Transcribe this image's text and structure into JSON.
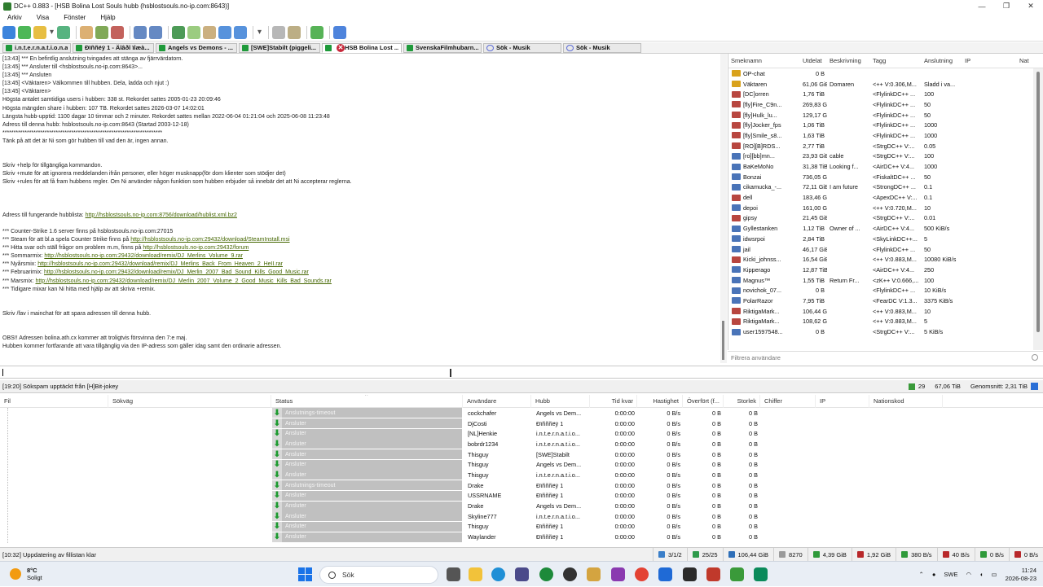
{
  "window": {
    "title": "DC++ 0.883 - [HSB Bolina Lost Souls hubb (hsblostsouls.no-ip.com:8643)]",
    "controls": [
      "—",
      "❐",
      "✕"
    ]
  },
  "menu": [
    "Arkiv",
    "Visa",
    "Fönster",
    "Hjälp"
  ],
  "toolbar": {
    "buttons": [
      "back-icon",
      "reconnect-icon",
      "favorite-hubs-icon",
      "favorite-dropdown-icon",
      "public-hubs-icon",
      "separator",
      "queue-icon",
      "finished-icon",
      "upload-queue-icon",
      "separator",
      "search-icon",
      "adl-search-icon",
      "separator",
      "spy-icon",
      "notepad-icon",
      "network-stats-icon",
      "download-icon",
      "refresh-icon",
      "separator",
      "settings-dropdown-icon",
      "separator",
      "gear-icon",
      "edit-icon",
      "separator",
      "plugin-icon",
      "separator",
      "help-icon"
    ]
  },
  "tabs": [
    {
      "label": "i.n.t.e.r.n.a.t.i.o.n.a.l...",
      "type": "hub",
      "width": 84
    },
    {
      "label": "Đïññëÿ 1 - Äîâðî ïîæà...",
      "type": "hub",
      "width": 100
    },
    {
      "label": "Angels vs Demons - ...",
      "type": "hub",
      "width": 100
    },
    {
      "label": "[SWE]Stabilt (piggeli...",
      "type": "hub",
      "width": 100
    },
    {
      "label": "HSB Bolina Lost ...",
      "type": "hub",
      "width": 98,
      "active": true,
      "close": "✕"
    },
    {
      "label": "SvenskaFilmhubarn...",
      "type": "hub",
      "width": 96
    },
    {
      "label": "Sök - Musik",
      "type": "search",
      "width": 96
    },
    {
      "label": "Sök - Musik",
      "type": "search",
      "width": 96
    }
  ],
  "chat": {
    "lines": [
      {
        "t": "[13:43] *** En befintlig anslutning tvingades att stänga av fjärrvärdatorn."
      },
      {
        "t": "[13:45] *** Ansluter till <hsblostsouls.no-ip.com:8643>..."
      },
      {
        "t": "[13:45] *** Ansluten"
      },
      {
        "t": "[13:45] <Väktaren> Välkommen till hubben. Dela, ladda och njut :)"
      },
      {
        "t": "[13:45] <Väktaren>"
      },
      {
        "t": "Högsta antalet samtidiga users i hubben: 338 st. Rekordet sattes 2005-01-23 20:09:46"
      },
      {
        "t": "Högsta mängden share i hubben: 107 TB. Rekordet sattes 2026-03-07 14:02:01"
      },
      {
        "t": "Längsta hubb-upptid: 1100 dagar 10 timmar och 2 minuter. Rekordet sattes mellan 2022-06-04 01:21:04 och 2025-06-08 11:23:48"
      },
      {
        "t": "Adress till denna hubb: hsblostsouls.no-ip.com:8643 (Startad 2003-12-18)"
      },
      {
        "t": "************************************************************************"
      },
      {
        "t": "Tänk på att det är Ni som gör hubben till vad den är, ingen annan."
      },
      {
        "t": ""
      },
      {
        "t": ""
      },
      {
        "t": "Skriv +help för tillgängliga kommandon."
      },
      {
        "t": "Skriv +mute för att ignorera meddelanden ifrån personer, eller höger musknapp(för dom klienter som stödjer det)"
      },
      {
        "t": "Skriv +rules för att få fram hubbens regler. Om Ni använder någon funktion som hubben erbjuder så innebär det att Ni accepterar reglerna."
      },
      {
        "t": ""
      },
      {
        "t": ""
      },
      {
        "t": ""
      },
      {
        "t": "Adress till fungerande hubblista: ",
        "link": "http://hsblostsouls.no-ip.com:8756/download/hublist.xml.bz2"
      },
      {
        "t": ""
      },
      {
        "t": "*** Counter-Strike 1.6 server finns på hsblostsouls.no-ip.com:27015"
      },
      {
        "t": "*** Steam för att bl.a spela Counter Strike finns på ",
        "link": "http://hsblostsouls.no-ip.com:29432/download/SteamInstall.msi"
      },
      {
        "t": "*** Hitta svar och ställ frågor om problem m.m, finns på ",
        "link": "http://hsblostsouls.no-ip.com:29432/forum"
      },
      {
        "t": "*** Sommarmix: ",
        "link": "http://hsblostsouls.no-ip.com:29432/download/remix/DJ_Merlins_Volume_9.rar"
      },
      {
        "t": "*** Nyårsmix: ",
        "link": "http://hsblostsouls.no-ip.com:29432/download/remix/DJ_Merlins_Back_From_Heaven_2_HeII.rar"
      },
      {
        "t": "*** Februarimix: ",
        "link": "http://hsblostsouls.no-ip.com:29432/download/remix/DJ_Merlin_2007_Bad_Sound_Kills_Good_Music.rar"
      },
      {
        "t": "*** Marsmix: ",
        "link": "http://hsblostsouls.no-ip.com:29432/download/remix/DJ_Merlin_2007_Volume_2_Good_Music_Kills_Bad_Sounds.rar"
      },
      {
        "t": "*** Tidigare mixar kan Ni hitta med hjälp av att skriva +remix."
      },
      {
        "t": ""
      },
      {
        "t": ""
      },
      {
        "t": "Skriv /fav i mainchat för att spara adressen till denna hubb."
      },
      {
        "t": ""
      },
      {
        "t": ""
      },
      {
        "t": "OBS!! Adressen bolina.ath.cx kommer att troligtvis försvinna den 7:e maj."
      },
      {
        "t": "Hubben kommer fortfarande att vara tillgänglig via den IP-adress som gäller idag samt den ordinarie adressen."
      }
    ]
  },
  "users": {
    "columns": [
      {
        "label": "Smeknamn",
        "w": 88
      },
      {
        "label": "Utdelat",
        "w": 33
      },
      {
        "label": "Beskrivning",
        "w": 53
      },
      {
        "label": "Tagg",
        "w": 63
      },
      {
        "label": "Anslutning",
        "w": 50
      },
      {
        "label": "IP",
        "w": 67
      },
      {
        "label": "Nat",
        "w": 22
      }
    ],
    "rows": [
      {
        "nick": "OP-chat",
        "share": "0 B",
        "desc": "",
        "tag": "",
        "conn": "",
        "icon": "#d9a21b"
      },
      {
        "nick": "Väktaren",
        "share": "61,06 GiB",
        "desc": "Domaren",
        "tag": "<++ V:0.306,M...",
        "conn": "Sladd i va...",
        "icon": "#d9a21b"
      },
      {
        "nick": "[DC]orren",
        "share": "1,76 TiB",
        "desc": "",
        "tag": "<FlylinkDC++ ...",
        "conn": "100",
        "icon": "#b8463f"
      },
      {
        "nick": "[fly]Fire_C9n...",
        "share": "269,83 GiB",
        "desc": "",
        "tag": "<FlylinkDC++ ...",
        "conn": "50",
        "icon": "#b8463f"
      },
      {
        "nick": "[fly]Hulk_lu...",
        "share": "129,17 GiB",
        "desc": "",
        "tag": "<FlylinkDC++ ...",
        "conn": "50",
        "icon": "#b8463f"
      },
      {
        "nick": "[fly]Jocker_fps",
        "share": "1,06 TiB",
        "desc": "",
        "tag": "<FlylinkDC++ ...",
        "conn": "1000",
        "icon": "#b8463f"
      },
      {
        "nick": "[fly]Smile_s8...",
        "share": "1,63 TiB",
        "desc": "",
        "tag": "<FlylinkDC++ ...",
        "conn": "1000",
        "icon": "#b8463f"
      },
      {
        "nick": "[RO][B]RDS...",
        "share": "2,77 TiB",
        "desc": "",
        "tag": "<StrgDC++ V:...",
        "conn": "0.05",
        "icon": "#b8463f"
      },
      {
        "nick": "[ro][bb]mn...",
        "share": "23,93 GiB",
        "desc": "cable",
        "tag": "<StrgDC++ V:...",
        "conn": "100",
        "icon": "#4a74b8"
      },
      {
        "nick": "BaKeMoNo",
        "share": "31,38 TiB",
        "desc": "Looking f...",
        "tag": "<AirDC++ V:4...",
        "conn": "1000",
        "icon": "#4a74b8"
      },
      {
        "nick": "Bonzai",
        "share": "736,05 GiB",
        "desc": "",
        "tag": "<FiskaltDC++ ...",
        "conn": "50",
        "icon": "#4a74b8"
      },
      {
        "nick": "cikamucka_-...",
        "share": "72,11 GiB",
        "desc": "I am future",
        "tag": "<StrongDC++ ...",
        "conn": "0.1",
        "icon": "#4a74b8"
      },
      {
        "nick": "dell",
        "share": "183,46 GiB",
        "desc": "",
        "tag": "<ApexDC++ V:...",
        "conn": "0.1",
        "icon": "#b8463f"
      },
      {
        "nick": "depoi",
        "share": "161,00 GiB",
        "desc": "",
        "tag": "<++ V:0.720,M...",
        "conn": "10",
        "icon": "#4a74b8"
      },
      {
        "nick": "gipsy",
        "share": "21,45 GiB",
        "desc": "",
        "tag": "<StrgDC++ V:...",
        "conn": "0.01",
        "icon": "#b8463f"
      },
      {
        "nick": "Gyllestanken",
        "share": "1,12 TiB",
        "desc": "Owner of ...",
        "tag": "<AirDC++ V:4...",
        "conn": "500 KiB/s",
        "icon": "#4a74b8"
      },
      {
        "nick": "idwsrpoi",
        "share": "2,84 TiB",
        "desc": "",
        "tag": "<SkyLinkDC++...",
        "conn": "5",
        "icon": "#4a74b8"
      },
      {
        "nick": "jail",
        "share": "46,17 GiB",
        "desc": "",
        "tag": "<FlylinkDC++ ...",
        "conn": "50",
        "icon": "#4a74b8"
      },
      {
        "nick": "Kicki_johnss...",
        "share": "16,54 GiB",
        "desc": "",
        "tag": "<++ V:0.883,M...",
        "conn": "10080 KiB/s",
        "icon": "#b8463f"
      },
      {
        "nick": "Kipperago",
        "share": "12,87 TiB",
        "desc": "",
        "tag": "<AirDC++ V:4...",
        "conn": "250",
        "icon": "#4a74b8"
      },
      {
        "nick": "Magnus™",
        "share": "1,55 TiB",
        "desc": "Return Fr...",
        "tag": "<zK++ V:0.666,...",
        "conn": "100",
        "icon": "#4a74b8"
      },
      {
        "nick": "novichok_07...",
        "share": "0 B",
        "desc": "",
        "tag": "<FlylinkDC++ ...",
        "conn": "10 KiB/s",
        "icon": "#4a74b8"
      },
      {
        "nick": "PolarRazor",
        "share": "7,95 TiB",
        "desc": "",
        "tag": "<FearDC V:1.3...",
        "conn": "3375 KiB/s",
        "icon": "#4a74b8"
      },
      {
        "nick": "RiktigaMark...",
        "share": "106,44 GiB",
        "desc": "",
        "tag": "<++ V:0.883,M...",
        "conn": "10",
        "icon": "#b8463f"
      },
      {
        "nick": "RiktigaMark...",
        "share": "108,62 GiB",
        "desc": "",
        "tag": "<++ V:0.883,M...",
        "conn": "5",
        "icon": "#b8463f"
      },
      {
        "nick": "user1597548...",
        "share": "0 B",
        "desc": "",
        "tag": "<StrgDC++ V:...",
        "conn": "5 KiB/s",
        "icon": "#4a74b8"
      }
    ],
    "filter_placeholder": "Filtrera användare"
  },
  "midstatus": {
    "left": "[19:20] Sökspam upptäckt från [H]Bit-jokey",
    "users": "29",
    "share": "67,06 TiB",
    "avg": "Genomsnitt: 2,31 TiB"
  },
  "transfers": {
    "columns": [
      {
        "label": "Fil",
        "w": 133
      },
      {
        "label": "Sökväg",
        "w": 200
      },
      {
        "label": "Status",
        "w": 235
      },
      {
        "label": "Användare",
        "w": 84
      },
      {
        "label": "Hubb",
        "w": 72
      },
      {
        "label": "Tid kvar",
        "w": 58
      },
      {
        "label": "Hastighet",
        "w": 56
      },
      {
        "label": "Överfört (f...",
        "w": 50
      },
      {
        "label": "Storlek",
        "w": 45
      },
      {
        "label": "Chiffer",
        "w": 68
      },
      {
        "label": "IP",
        "w": 66
      },
      {
        "label": "Nationskod",
        "w": 90
      }
    ],
    "rows": [
      {
        "status": "Anslutnings-timeout",
        "user": "cockchafer",
        "hub": "Angels vs Dem...",
        "time": "0:00:00",
        "speed": "0 B/s",
        "transferred": "0 B",
        "size": "0 B"
      },
      {
        "status": "Ansluter",
        "user": "DjCosti",
        "hub": "Đïñññëÿ 1",
        "time": "0:00:00",
        "speed": "0 B/s",
        "transferred": "0 B",
        "size": "0 B"
      },
      {
        "status": "Ansluter",
        "user": "[NL]Henkie",
        "hub": "i.n.t.e.r.n.a.t.i.o...",
        "time": "0:00:00",
        "speed": "0 B/s",
        "transferred": "0 B",
        "size": "0 B"
      },
      {
        "status": "Ansluter",
        "user": "bobrdr1234",
        "hub": "i.n.t.e.r.n.a.t.i.o...",
        "time": "0:00:00",
        "speed": "0 B/s",
        "transferred": "0 B",
        "size": "0 B"
      },
      {
        "status": "Ansluter",
        "user": "Thisguy",
        "hub": "[SWE]Stabilt",
        "time": "0:00:00",
        "speed": "0 B/s",
        "transferred": "0 B",
        "size": "0 B"
      },
      {
        "status": "Ansluter",
        "user": "Thisguy",
        "hub": "Angels vs Dem...",
        "time": "0:00:00",
        "speed": "0 B/s",
        "transferred": "0 B",
        "size": "0 B"
      },
      {
        "status": "Ansluter",
        "user": "Thisguy",
        "hub": "i.n.t.e.r.n.a.t.i.o...",
        "time": "0:00:00",
        "speed": "0 B/s",
        "transferred": "0 B",
        "size": "0 B"
      },
      {
        "status": "Anslutnings-timeout",
        "user": "Drake",
        "hub": "Đïñññëÿ 1",
        "time": "0:00:00",
        "speed": "0 B/s",
        "transferred": "0 B",
        "size": "0 B"
      },
      {
        "status": "Ansluter",
        "user": "USSRNAME",
        "hub": "Đïñññëÿ 1",
        "time": "0:00:00",
        "speed": "0 B/s",
        "transferred": "0 B",
        "size": "0 B"
      },
      {
        "status": "Ansluter",
        "user": "Drake",
        "hub": "Angels vs Dem...",
        "time": "0:00:00",
        "speed": "0 B/s",
        "transferred": "0 B",
        "size": "0 B"
      },
      {
        "status": "Ansluter",
        "user": "Skyline777",
        "hub": "i.n.t.e.r.n.a.t.i.o...",
        "time": "0:00:00",
        "speed": "0 B/s",
        "transferred": "0 B",
        "size": "0 B"
      },
      {
        "status": "Ansluter",
        "user": "Thisguy",
        "hub": "Đïñññëÿ 1",
        "time": "0:00:00",
        "speed": "0 B/s",
        "transferred": "0 B",
        "size": "0 B"
      },
      {
        "status": "Ansluter",
        "user": "Waylander",
        "hub": "Đïñññëÿ 1",
        "time": "0:00:00",
        "speed": "0 B/s",
        "transferred": "0 B",
        "size": "0 B"
      }
    ]
  },
  "bottomstatus": {
    "left": "[10:32] Uppdatering av fillistan klar",
    "segments": [
      {
        "label": "3/1/2",
        "icon": "#3b7fc9",
        "name": "hubs-count"
      },
      {
        "label": "25/25",
        "icon": "#2e9a4a",
        "name": "slots"
      },
      {
        "label": "106,44 GiB",
        "icon": "#2f6fb8",
        "name": "shared"
      },
      {
        "label": "8270",
        "icon": "#9a9a9a",
        "name": "files"
      },
      {
        "label": "4,39 GiB",
        "icon": "#2f9a3a",
        "name": "downloaded"
      },
      {
        "label": "1,92 GiB",
        "icon": "#b8282a",
        "name": "uploaded"
      },
      {
        "label": "380 B/s",
        "icon": "#2f9a3a",
        "name": "down-speed"
      },
      {
        "label": "40 B/s",
        "icon": "#b8282a",
        "name": "up-speed"
      },
      {
        "label": "0 B/s",
        "icon": "#2f9a3a",
        "name": "down-limit"
      },
      {
        "label": "0 B/s",
        "icon": "#b8282a",
        "name": "up-limit"
      }
    ]
  },
  "taskbar": {
    "temp": "8°C",
    "weather": "Soligt",
    "search": "Sök",
    "lang": "SWE",
    "time": "11:24",
    "date": "2026-08-23"
  }
}
